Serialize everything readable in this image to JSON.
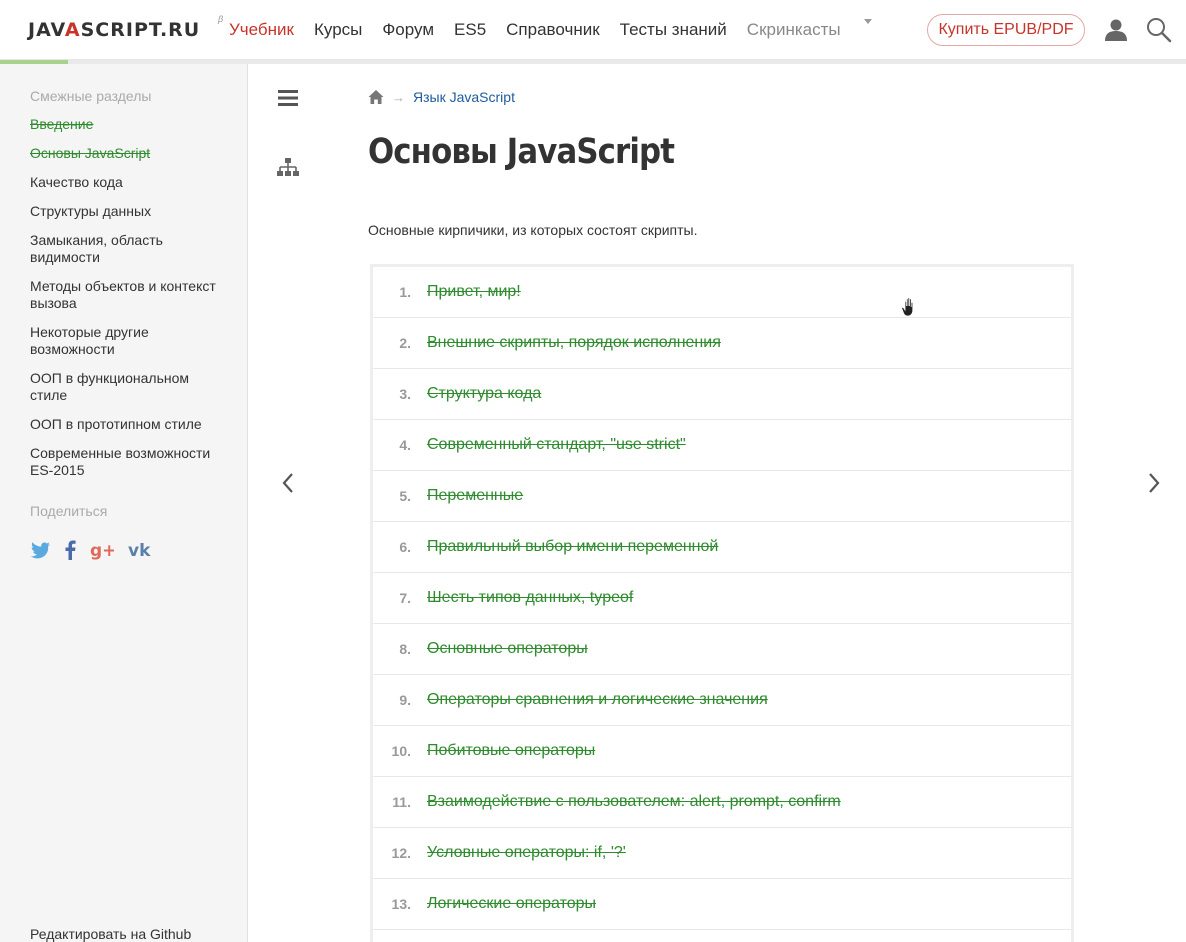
{
  "header": {
    "logo": {
      "prefix": "JAV",
      "accent": "A",
      "suffix": "SCRIPT.RU",
      "beta": "β"
    },
    "nav": [
      {
        "label": "Учебник",
        "state": "active"
      },
      {
        "label": "Курсы",
        "state": "normal"
      },
      {
        "label": "Форум",
        "state": "normal"
      },
      {
        "label": "ES5",
        "state": "normal"
      },
      {
        "label": "Справочник",
        "state": "normal"
      },
      {
        "label": "Тесты знаний",
        "state": "normal"
      },
      {
        "label": "Скринкасты",
        "state": "muted"
      }
    ],
    "buy_label": "Купить EPUB/PDF",
    "user_icon": "user-icon",
    "search_icon": "search-icon"
  },
  "sidebar": {
    "heading": "Смежные разделы",
    "items": [
      {
        "label": "Введение",
        "done": true
      },
      {
        "label": "Основы JavaScript",
        "done": true
      },
      {
        "label": "Качество кода",
        "done": false
      },
      {
        "label": "Структуры данных",
        "done": false
      },
      {
        "label": "Замыкания, область видимости",
        "done": false
      },
      {
        "label": "Методы объектов и контекст вызова",
        "done": false
      },
      {
        "label": "Некоторые другие возможности",
        "done": false
      },
      {
        "label": "ООП в функциональном стиле",
        "done": false
      },
      {
        "label": "ООП в прототипном стиле",
        "done": false
      },
      {
        "label": "Современные возможности ES-2015",
        "done": false
      }
    ],
    "share_heading": "Поделиться",
    "share_icons": [
      "twitter-icon",
      "facebook-icon",
      "google-plus-icon",
      "vk-icon"
    ],
    "edit_label": "Редактировать на Github"
  },
  "breadcrumb": {
    "home_icon": "home-icon",
    "separator": "→",
    "crumb": "Язык JavaScript"
  },
  "main": {
    "title": "Основы JavaScript",
    "lead": "Основные кирпичики, из которых состоят скрипты.",
    "lessons": [
      {
        "num": "1.",
        "title": "Привет, мир!"
      },
      {
        "num": "2.",
        "title": "Внешние скрипты, порядок исполнения"
      },
      {
        "num": "3.",
        "title": "Структура кода"
      },
      {
        "num": "4.",
        "title": "Современный стандарт, \"use strict\""
      },
      {
        "num": "5.",
        "title": "Переменные"
      },
      {
        "num": "6.",
        "title": "Правильный выбор имени переменной"
      },
      {
        "num": "7.",
        "title": "Шесть типов данных, typeof"
      },
      {
        "num": "8.",
        "title": "Основные операторы"
      },
      {
        "num": "9.",
        "title": "Операторы сравнения и логические значения"
      },
      {
        "num": "10.",
        "title": "Побитовые операторы"
      },
      {
        "num": "11.",
        "title": "Взаимодействие с пользователем: alert, prompt, confirm"
      },
      {
        "num": "12.",
        "title": "Условные операторы: if, '?'"
      },
      {
        "num": "13.",
        "title": "Логические операторы"
      },
      {
        "num": "",
        "title": ""
      }
    ]
  },
  "colors": {
    "accent": "#c6342b",
    "done": "#2e8b2e",
    "link": "#1d5c9c"
  }
}
